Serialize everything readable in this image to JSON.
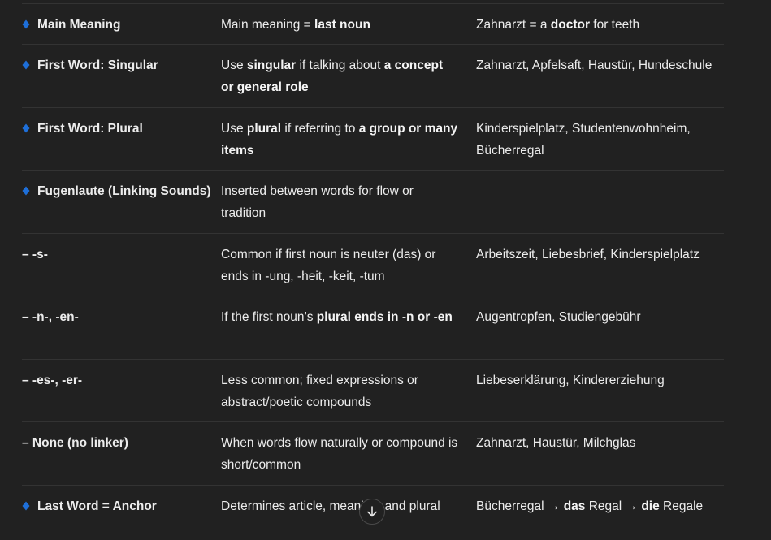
{
  "colors": {
    "background": "#212121",
    "text": "#ececec",
    "divider": "#333333",
    "diamond": "#1e6fd9"
  },
  "icons": {
    "row_marker": "blue-diamond-icon",
    "scroll": "arrow-down-icon"
  },
  "rows": [
    {
      "marker": "diamond",
      "label": "Main Meaning",
      "desc": [
        {
          "t": "Main meaning = "
        },
        {
          "t": "last noun",
          "b": true
        }
      ],
      "ex": [
        {
          "t": "Zahnarzt = a "
        },
        {
          "t": "doctor",
          "b": true
        },
        {
          "t": " for teeth"
        }
      ]
    },
    {
      "marker": "diamond",
      "label": "First Word: Singular",
      "desc": [
        {
          "t": "Use "
        },
        {
          "t": "singular",
          "b": true
        },
        {
          "t": " if talking about "
        },
        {
          "t": "a concept or general role",
          "b": true
        }
      ],
      "ex": [
        {
          "t": "Zahnarzt, Apfelsaft, Haustür, Hundeschule"
        }
      ]
    },
    {
      "marker": "diamond",
      "label": "First Word: Plural",
      "desc": [
        {
          "t": "Use "
        },
        {
          "t": "plural",
          "b": true
        },
        {
          "t": " if referring to "
        },
        {
          "t": "a group or many items",
          "b": true
        }
      ],
      "ex": [
        {
          "t": "Kinderspielplatz, Studentenwohnheim, Bücherregal"
        }
      ]
    },
    {
      "marker": "diamond",
      "label": "Fugenlaute (Linking Sounds)",
      "desc": [
        {
          "t": "Inserted between words for flow or tradition"
        }
      ],
      "ex": []
    },
    {
      "marker": "dash",
      "label": "– -s-",
      "desc": [
        {
          "t": "Common if first noun is neuter (das) or ends in -ung, -heit, -keit, -tum"
        }
      ],
      "ex": [
        {
          "t": "Arbeitszeit, Liebesbrief, Kinderspielplatz"
        }
      ]
    },
    {
      "marker": "dash",
      "label": "– -n-, -en-",
      "desc": [
        {
          "t": "If the first noun’s "
        },
        {
          "t": "plural ends in -n or -en",
          "b": true
        }
      ],
      "ex": [
        {
          "t": "Augentropfen, Studiengebühr"
        }
      ]
    },
    {
      "marker": "dash",
      "label": "– -es-, -er-",
      "desc": [
        {
          "t": "Less common; fixed expressions or abstract/poetic compounds"
        }
      ],
      "ex": [
        {
          "t": "Liebeserklärung, Kindererziehung"
        }
      ]
    },
    {
      "marker": "dash",
      "label": "– None (no linker)",
      "desc": [
        {
          "t": "When words flow naturally or compound is short/common"
        }
      ],
      "ex": [
        {
          "t": "Zahnarzt, Haustür, Milchglas"
        }
      ]
    },
    {
      "marker": "diamond",
      "label": "Last Word = Anchor",
      "desc": [
        {
          "t": "Determines article, meaning, and plural"
        }
      ],
      "ex": [
        {
          "t": "Bücherregal → "
        },
        {
          "t": "das",
          "b": true
        },
        {
          "t": " Regal → "
        },
        {
          "t": "die",
          "b": true
        },
        {
          "t": " Regale"
        }
      ]
    }
  ]
}
